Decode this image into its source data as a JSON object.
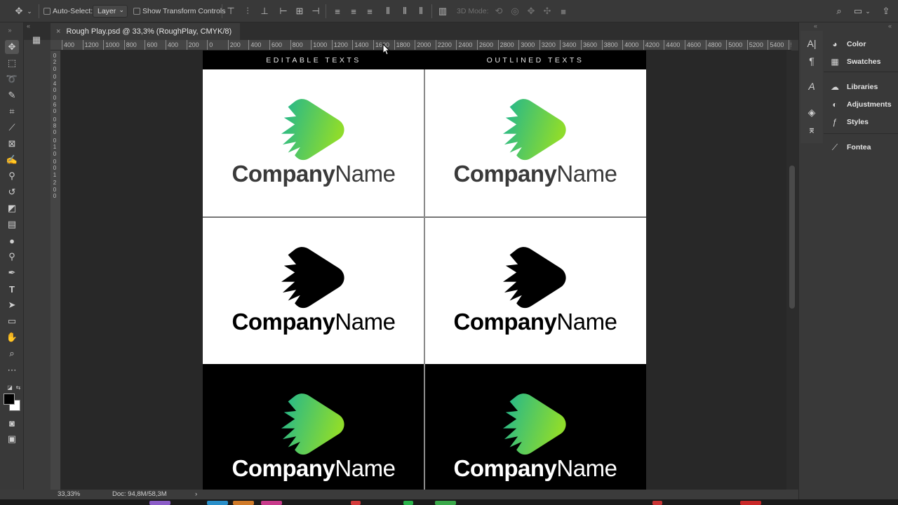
{
  "options_bar": {
    "auto_select_label": "Auto-Select:",
    "auto_select_value": "Layer",
    "show_transform_label": "Show Transform Controls",
    "mode_3d_label": "3D Mode:"
  },
  "document_tab": {
    "close_glyph": "×",
    "title": "Rough Play.psd @ 33,3% (RoughPlay, CMYK/8)"
  },
  "ruler_h_ticks": [
    "400",
    "1200",
    "1000",
    "800",
    "600",
    "400",
    "200",
    "0",
    "200",
    "400",
    "600",
    "800",
    "1000",
    "1200",
    "1400",
    "1600",
    "1800",
    "2000",
    "2200",
    "2400",
    "2600",
    "2800",
    "3000",
    "3200",
    "3400",
    "3600",
    "3800",
    "4000",
    "4200",
    "4400",
    "4600",
    "4800",
    "5000",
    "5200",
    "5400",
    "5"
  ],
  "ruler_v_labels": [
    "0",
    "2",
    "0",
    "0",
    "4",
    "0",
    "0",
    "6",
    "0",
    "0",
    "8",
    "0",
    "0",
    "1",
    "0",
    "0",
    "0",
    "1",
    "2",
    "0",
    "0"
  ],
  "artboard": {
    "left_header": "EDITABLE TEXTS",
    "right_header": "OUTLINED TEXTS",
    "company_bold": "Company",
    "company_light": "Name"
  },
  "status_bar": {
    "zoom": "33,33%",
    "doc_info": "Doc: 94,8M/58,3M",
    "arrow": "›"
  },
  "panels": [
    {
      "label": "Color",
      "icon": "color-icon"
    },
    {
      "label": "Swatches",
      "icon": "swatches-icon"
    },
    {
      "label": "Libraries",
      "icon": "libraries-icon"
    },
    {
      "label": "Adjustments",
      "icon": "adjustments-icon"
    },
    {
      "label": "Styles",
      "icon": "styles-icon"
    },
    {
      "label": "Fontea",
      "icon": "fontea-icon"
    }
  ],
  "colors": {
    "logo_gradient_start": "#1db592",
    "logo_gradient_end": "#8edc2c",
    "canvas_bg": "#282828",
    "ui_bg": "#393939"
  }
}
